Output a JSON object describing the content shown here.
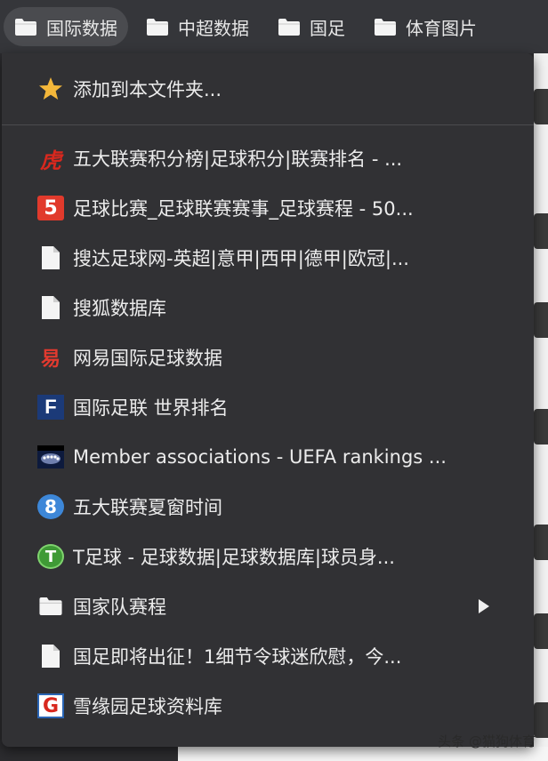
{
  "bookmarks_bar": {
    "folders": [
      {
        "label": "国际数据",
        "active": true
      },
      {
        "label": "中超数据",
        "active": false
      },
      {
        "label": "国足",
        "active": false
      },
      {
        "label": "体育图片",
        "active": false
      }
    ]
  },
  "menu": {
    "add_to_folder": "添加到本文件夹...",
    "items": [
      {
        "label": "五大联赛积分榜|足球积分|联赛排名 - ...",
        "icon": "hupu-tiger-icon"
      },
      {
        "label": "足球比赛_足球联赛赛事_足球赛程 - 50...",
        "icon": "500-five-icon"
      },
      {
        "label": "搜达足球网-英超|意甲|西甲|德甲|欧冠|...",
        "icon": "blank-page-icon"
      },
      {
        "label": "搜狐数据库",
        "icon": "blank-page-icon"
      },
      {
        "label": "网易国际足球数据",
        "icon": "netease-icon"
      },
      {
        "label": "国际足联 世界排名",
        "icon": "fifa-icon"
      },
      {
        "label": "Member associations - UEFA rankings ...",
        "icon": "uefa-icon"
      },
      {
        "label": "五大联赛夏窗时间",
        "icon": "eight-circle-icon"
      },
      {
        "label": "T足球 - 足球数据|足球数据库|球员身...",
        "icon": "t-football-icon"
      },
      {
        "label": "国家队赛程",
        "icon": "folder-icon",
        "submenu": true
      },
      {
        "label": "国足即将出征！1细节令球迷欣慰，今...",
        "icon": "blank-page-icon"
      },
      {
        "label": "雪缘园足球资料库",
        "icon": "g-logo-icon"
      }
    ]
  },
  "icon_glyphs": {
    "hupu": "虎",
    "five": "5",
    "netease": "易",
    "fifa": "F",
    "eight": "8",
    "t": "T",
    "g": "G"
  },
  "colors": {
    "menu_bg": "#313134",
    "bar_bg": "#35363a",
    "star": "#f4b73a",
    "text": "#ececec"
  },
  "watermark": "头条 @猫狗体育"
}
